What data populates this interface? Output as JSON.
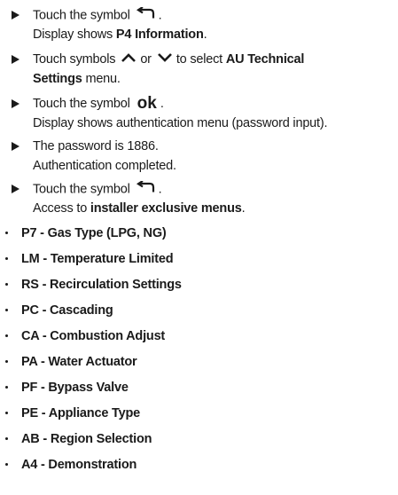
{
  "steps": [
    {
      "line1_pre": "Touch the symbol",
      "line1_icon": "back-arrow-icon",
      "line1_post": ".",
      "line2_pre": "Display shows ",
      "line2_bold": "P4 Information",
      "line2_post": "."
    },
    {
      "line1_pre": "Touch symbols",
      "icon_up": "chevron-up-icon",
      "or_text": "or",
      "icon_down": "chevron-down-icon",
      "line1_mid": "to select ",
      "line1_bold": "AU Technical",
      "line2_bold": "Settings",
      "line2_post": " menu."
    },
    {
      "line1_pre": "Touch the symbol",
      "ok_symbol": "ok",
      "line1_post": ".",
      "line2": "Display shows authentication menu (password input)."
    },
    {
      "line1": "The password is 1886.",
      "line2": "Authentication completed."
    },
    {
      "line1_pre": "Touch the symbol",
      "line1_icon": "back-arrow-icon",
      "line1_post": ".",
      "line2_pre": "Access to ",
      "line2_bold": "installer exclusive menus",
      "line2_post": "."
    }
  ],
  "menus": [
    "P7 - Gas Type (LPG, NG)",
    "LM - Temperature Limited",
    "RS - Recirculation Settings",
    "PC - Cascading",
    "CA - Combustion Adjust",
    "PA - Water Actuator",
    "PF - Bypass Valve",
    "PE - Appliance Type",
    "AB - Region Selection",
    "A4 - Demonstration"
  ]
}
